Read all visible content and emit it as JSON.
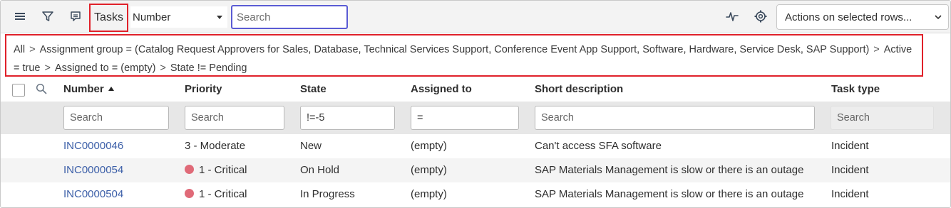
{
  "toolbar": {
    "menu_icon": "hamburger-menu-icon",
    "filter_icon": "filter-icon",
    "comment_icon": "comment-icon",
    "list_title": "Tasks",
    "search_field_select": "Number",
    "search_placeholder": "Search",
    "activity_icon": "pulse-icon",
    "settings_icon": "gear-icon",
    "actions_select": "Actions on selected rows..."
  },
  "breadcrumb": {
    "items": [
      "All",
      "Assignment group = (Catalog Request Approvers for Sales, Database, Technical Services Support, Conference Event App Support, Software, Hardware, Service Desk, SAP Support)",
      "Active = true",
      "Assigned to = (empty)",
      "State != Pending"
    ],
    "separator": ">"
  },
  "columns": {
    "number": "Number",
    "priority": "Priority",
    "state": "State",
    "assigned_to": "Assigned to",
    "short_description": "Short description",
    "task_type": "Task type"
  },
  "filters": {
    "number": {
      "placeholder": "Search",
      "value": ""
    },
    "priority": {
      "placeholder": "Search",
      "value": ""
    },
    "state": {
      "placeholder": "Search",
      "value": "!=-5"
    },
    "assigned_to": {
      "placeholder": "Search",
      "value": "="
    },
    "short_description": {
      "placeholder": "Search",
      "value": ""
    },
    "task_type": {
      "placeholder": "Search",
      "value": ""
    }
  },
  "rows": [
    {
      "number": "INC0000046",
      "priority": "3 - Moderate",
      "priority_dot": "",
      "state": "New",
      "assigned_to": "(empty)",
      "short_description": "Can't access SFA software",
      "task_type": "Incident"
    },
    {
      "number": "INC0000054",
      "priority": "1 - Critical",
      "priority_dot": "#e06a78",
      "state": "On Hold",
      "assigned_to": "(empty)",
      "short_description": "SAP Materials Management is slow or there is an outage",
      "task_type": "Incident"
    },
    {
      "number": "INC0000504",
      "priority": "1 - Critical",
      "priority_dot": "#e06a78",
      "state": "In Progress",
      "assigned_to": "(empty)",
      "short_description": "SAP Materials Management is slow or there is an outage",
      "task_type": "Incident"
    }
  ],
  "colors": {
    "highlight_border": "#e0212a",
    "search_focus": "#5a5bd4",
    "link": "#3c5fa8",
    "critical_dot": "#e06a78"
  }
}
